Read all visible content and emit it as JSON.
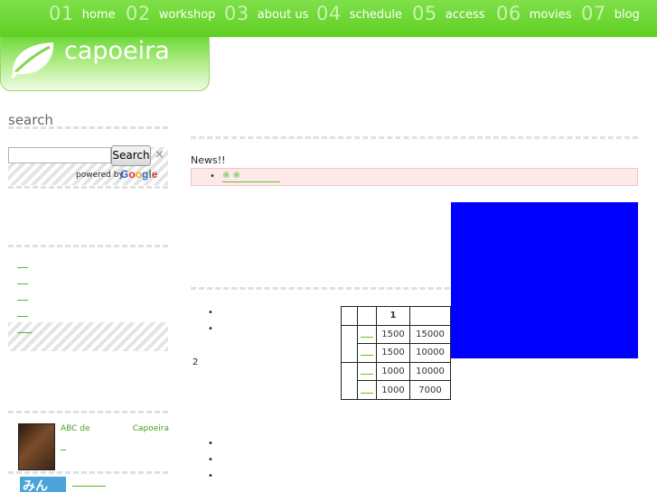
{
  "nav": [
    {
      "num": "01",
      "label": "home"
    },
    {
      "num": "02",
      "label": "workshop"
    },
    {
      "num": "03",
      "label": "about us"
    },
    {
      "num": "04",
      "label": "schedule"
    },
    {
      "num": "05",
      "label": "access"
    },
    {
      "num": "06",
      "label": "movies"
    },
    {
      "num": "07",
      "label": "blog"
    }
  ],
  "logo": {
    "text": "capoeira"
  },
  "sidebar": {
    "search_heading": "search",
    "search_button": "Search",
    "clear_symbol": "×",
    "powered_by": "powered by",
    "google": "Google",
    "book_title_left": "ABC de",
    "book_title_right": "Capoeira",
    "thumb2_text": "みん"
  },
  "main": {
    "news_title": "News!!",
    "news_item": "※ ※",
    "note": "2",
    "colors": {
      "accent": "#5fcf22",
      "blue_block": "#0000ff",
      "news_bg": "#fde8ea"
    },
    "price_table": {
      "header": "1",
      "rows": [
        {
          "a": "1500",
          "b": "15000"
        },
        {
          "a": "1500",
          "b": "10000"
        },
        {
          "a": "1000",
          "b": "10000"
        },
        {
          "a": "1000",
          "b": "7000"
        }
      ]
    }
  }
}
